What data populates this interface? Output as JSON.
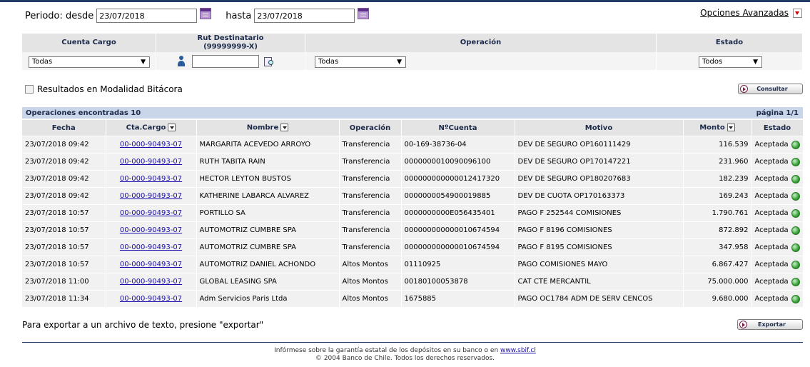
{
  "period": {
    "desde_label": "Periodo: desde",
    "desde_value": "23/07/2018",
    "hasta_label": "hasta",
    "hasta_value": "23/07/2018"
  },
  "opciones_avanzadas": "Opciones Avanzadas",
  "filters": {
    "cuenta_cargo": {
      "header": "Cuenta Cargo",
      "value": "Todas"
    },
    "rut": {
      "header_line1": "Rut Destinatario",
      "header_line2": "(99999999-X)",
      "value": ""
    },
    "operacion": {
      "header": "Operación",
      "value": "Todas"
    },
    "estado": {
      "header": "Estado",
      "value": "Todos"
    }
  },
  "bitacora_label": "Resultados en Modalidad Bitácora",
  "consultar_label": "Consultar",
  "results": {
    "title": "Operaciones encontradas 10",
    "page": "página 1/1",
    "columns": [
      "Fecha",
      "Cta.Cargo",
      "Nombre",
      "Operación",
      "NºCuenta",
      "Motivo",
      "Monto",
      "Estado"
    ],
    "rows": [
      {
        "fecha": "23/07/2018 09:42",
        "cta": "00-000-90493-07",
        "nombre": "MARGARITA ACEVEDO ARROYO",
        "operacion": "Transferencia",
        "cuenta": "00-169-38736-04",
        "motivo": "DEV DE SEGURO OP160111429",
        "monto": "116.539",
        "estado": "Aceptada"
      },
      {
        "fecha": "23/07/2018 09:42",
        "cta": "00-000-90493-07",
        "nombre": "RUTH TABITA RAIN",
        "operacion": "Transferencia",
        "cuenta": "0000000010090096100",
        "motivo": "DEV DE SEGURO OP170147221",
        "monto": "231.960",
        "estado": "Aceptada"
      },
      {
        "fecha": "23/07/2018 09:42",
        "cta": "00-000-90493-07",
        "nombre": "HECTOR LEYTON BUSTOS",
        "operacion": "Transferencia",
        "cuenta": "000000000000012417320",
        "motivo": "DEV DE SEGURO OP180207683",
        "monto": "182.239",
        "estado": "Aceptada"
      },
      {
        "fecha": "23/07/2018 09:42",
        "cta": "00-000-90493-07",
        "nombre": "KATHERINE LABARCA ALVAREZ",
        "operacion": "Transferencia",
        "cuenta": "0000000054900019885",
        "motivo": "DEV DE CUOTA OP170163373",
        "monto": "169.243",
        "estado": "Aceptada"
      },
      {
        "fecha": "23/07/2018 10:57",
        "cta": "00-000-90493-07",
        "nombre": "PORTILLO SA",
        "operacion": "Transferencia",
        "cuenta": "0000000000E056435401",
        "motivo": "PAGO F 252544 COMISIONES",
        "monto": "1.790.761",
        "estado": "Aceptada"
      },
      {
        "fecha": "23/07/2018 10:57",
        "cta": "00-000-90493-07",
        "nombre": "AUTOMOTRIZ CUMBRE SPA",
        "operacion": "Transferencia",
        "cuenta": "000000000000010674594",
        "motivo": "PAGO F 8196 COMISIONES",
        "monto": "872.892",
        "estado": "Aceptada"
      },
      {
        "fecha": "23/07/2018 10:57",
        "cta": "00-000-90493-07",
        "nombre": "AUTOMOTRIZ CUMBRE SPA",
        "operacion": "Transferencia",
        "cuenta": "000000000000010674594",
        "motivo": "PAGO F 8195 COMISIONES",
        "monto": "347.958",
        "estado": "Aceptada"
      },
      {
        "fecha": "23/07/2018 10:57",
        "cta": "00-000-90493-07",
        "nombre": "AUTOMOTRIZ DANIEL ACHONDO",
        "operacion": "Altos Montos",
        "cuenta": "01110925",
        "motivo": "PAGO COMISIONES MAYO",
        "monto": "6.867.427",
        "estado": "Aceptada"
      },
      {
        "fecha": "23/07/2018 11:00",
        "cta": "00-000-90493-07",
        "nombre": "GLOBAL LEASING SPA",
        "operacion": "Altos Montos",
        "cuenta": "00180100053878",
        "motivo": "CAT CTE MERCANTIL",
        "monto": "75.000.000",
        "estado": "Aceptada"
      },
      {
        "fecha": "23/07/2018 11:34",
        "cta": "00-000-90493-07",
        "nombre": "Adm Servicios Paris Ltda",
        "operacion": "Altos Montos",
        "cuenta": "1675885",
        "motivo": "PAGO OC1784 ADM DE SERV CENCOS",
        "monto": "9.680.000",
        "estado": "Aceptada"
      }
    ]
  },
  "export_text": "Para exportar a un archivo de texto, presione \"exportar\"",
  "exportar_label": "Exportar",
  "footer": {
    "line1_text": "Infórmese sobre la garantía estatal de los depósitos en su banco o en ",
    "line1_link": "www.sbif.cl",
    "line2": "© 2004 Banco de Chile. Todos los derechos reservados."
  },
  "colors": {
    "header_bg": "#e4e4e4",
    "results_bar": "#c9d5e8",
    "row_bg": "#f1f1f1",
    "status_ok": "#34a334",
    "accent": "#1f3b66"
  },
  "icons": [
    "calendar-icon",
    "chevron-down-icon",
    "person-icon",
    "search-document-icon",
    "play-icon",
    "sort-icon",
    "status-ok-icon"
  ]
}
